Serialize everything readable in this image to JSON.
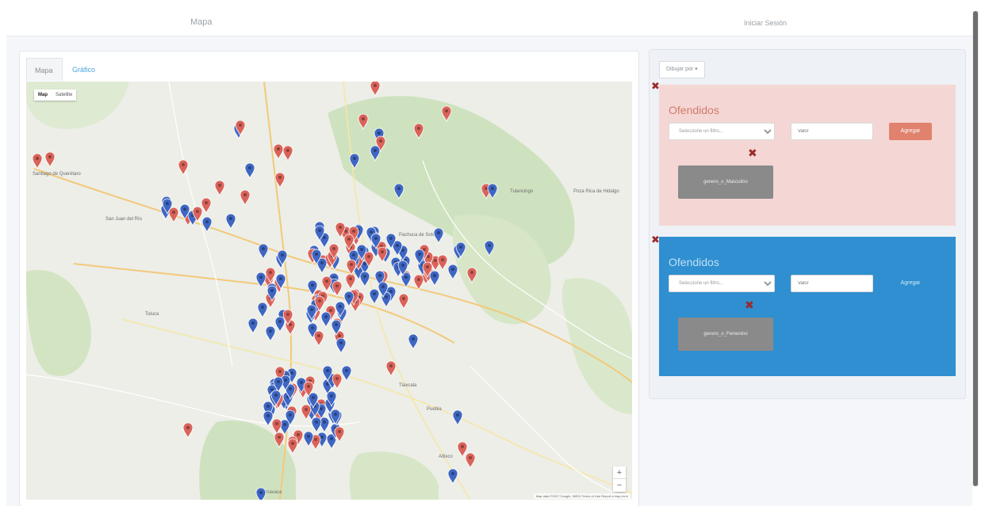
{
  "header": {
    "brand": "Mapa",
    "login": "Iniciar Sesión"
  },
  "tabs": [
    {
      "label": "Mapa",
      "active": true
    },
    {
      "label": "Gráfico",
      "active": false
    }
  ],
  "map": {
    "map_type": [
      "Map",
      "Satellite"
    ],
    "zoom_in": "+",
    "zoom_out": "−",
    "attribution": "Map data ©2017 Google, INEGI   Terms of Use   Report a map error",
    "marker_colors": {
      "red": "#d9635a",
      "blue": "#3f66c2"
    },
    "place_labels": [
      "Santiago de Querétaro",
      "San Juan del Río",
      "Pachuca de Soto",
      "Tulancingo",
      "Tlaxcala",
      "Toluca",
      "Cuernavaca",
      "Puebla",
      "Atlixco",
      "Poza Rica de Hidalgo"
    ]
  },
  "controls": {
    "dropdown_label": "Dibujar por ▾",
    "remove_icon": "✖",
    "cards": [
      {
        "theme": "pink",
        "title": "Ofendidos",
        "select_value": "Seleccione un filtro...",
        "input_placeholder": "Valor",
        "add_label": "Agregar",
        "generate_label": "genero_o_Masculino"
      },
      {
        "theme": "blue",
        "title": "Ofendidos",
        "select_value": "Seleccione un filtro...",
        "input_placeholder": "Valor",
        "add_label": "Agregar",
        "generate_label": "genero_o_Femenino"
      }
    ]
  },
  "colors": {
    "accent_blue": "#2f8fd0",
    "accent_pink": "#f4d7d4",
    "brand_text": "#9aa0a6"
  }
}
